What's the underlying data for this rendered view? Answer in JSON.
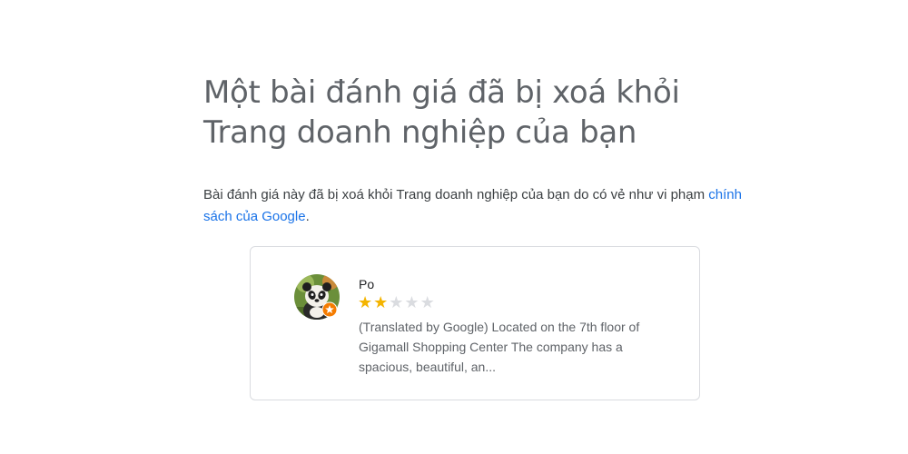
{
  "header": {
    "title": "Một bài đánh giá đã bị xoá khỏi Trang doanh nghiệp của bạn"
  },
  "message": {
    "text": "Bài đánh giá này đã bị xoá khỏi Trang doanh nghiệp của bạn do có vẻ như vi phạm ",
    "link_text": "chính sách của Google",
    "suffix": "."
  },
  "review": {
    "reviewer_name": "Po",
    "rating": 2,
    "max_rating": 5,
    "text": "(Translated by Google) Located on the 7th floor of Gigamall Shopping Center The company has a spacious, beautiful, an...",
    "avatar_icon": "panda-avatar-icon",
    "badge_icon": "local-guide-badge-icon"
  },
  "colors": {
    "title": "#5f6368",
    "link": "#1a73e8",
    "star_filled": "#f4b400",
    "star_empty": "#dadce0",
    "card_border": "#dadce0",
    "badge": "#f57c00"
  }
}
